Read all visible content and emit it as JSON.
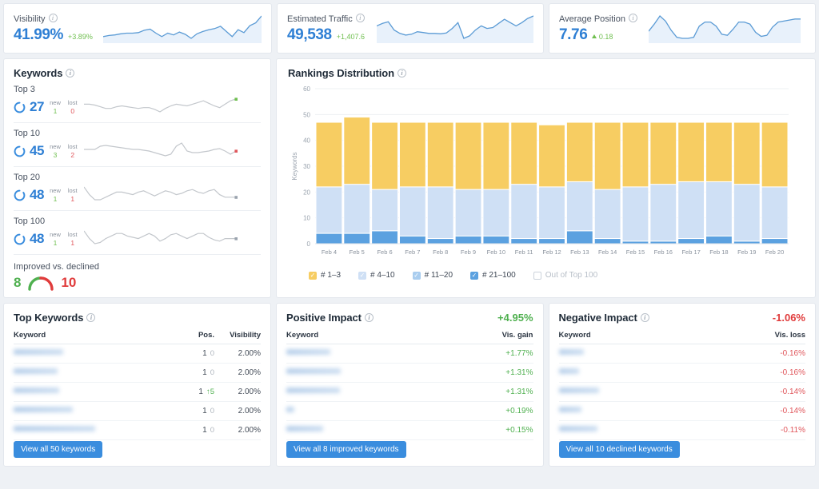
{
  "kpis": [
    {
      "label": "Visibility",
      "value": "41.99%",
      "delta": "+3.89%",
      "delta_dir": "up",
      "name": "visibility"
    },
    {
      "label": "Estimated Traffic",
      "value": "49,538",
      "delta": "+1,407.6",
      "delta_dir": "up",
      "name": "estimated-traffic"
    },
    {
      "label": "Average Position",
      "value": "7.76",
      "delta": "0.18",
      "delta_dir": "up",
      "name": "average-position"
    }
  ],
  "kpi_sparks": {
    "visibility": [
      52,
      50,
      49,
      47,
      46,
      46,
      45,
      41,
      39,
      46,
      52,
      46,
      49,
      44,
      48,
      55,
      47,
      43,
      40,
      38,
      34,
      43,
      52,
      40,
      45,
      33,
      28,
      16
    ],
    "estimated_traffic": [
      30,
      24,
      20,
      40,
      48,
      52,
      50,
      44,
      46,
      48,
      48,
      49,
      47,
      36,
      22,
      60,
      54,
      40,
      30,
      36,
      34,
      24,
      14,
      22,
      30,
      22,
      12,
      6
    ],
    "average_position": [
      44,
      30,
      14,
      24,
      42,
      56,
      58,
      58,
      56,
      34,
      26,
      26,
      34,
      50,
      52,
      40,
      26,
      26,
      30,
      46,
      54,
      52,
      36,
      26,
      24,
      22,
      20,
      20
    ]
  },
  "keywords_panel": {
    "title": "Keywords",
    "tiers": [
      {
        "tier": "Top 3",
        "count": "27",
        "new": "1",
        "lost": "0",
        "end_dot": "green",
        "spark": [
          30,
          30,
          29,
          27,
          25,
          25,
          27,
          28,
          27,
          26,
          25,
          26,
          26,
          24,
          21,
          25,
          28,
          30,
          29,
          28,
          30,
          32,
          34,
          31,
          28,
          26,
          30,
          34,
          36
        ]
      },
      {
        "tier": "Top 10",
        "count": "45",
        "new": "3",
        "lost": "2",
        "end_dot": "red",
        "spark": [
          26,
          26,
          26,
          30,
          31,
          30,
          29,
          28,
          27,
          26,
          26,
          25,
          24,
          22,
          20,
          18,
          20,
          30,
          34,
          24,
          22,
          22,
          23,
          24,
          26,
          27,
          24,
          20,
          24
        ]
      },
      {
        "tier": "Top 20",
        "count": "48",
        "new": "1",
        "lost": "1",
        "end_dot": "grey",
        "spark": [
          30,
          24,
          20,
          20,
          22,
          24,
          26,
          26,
          25,
          24,
          26,
          27,
          25,
          23,
          25,
          27,
          26,
          24,
          25,
          27,
          28,
          26,
          25,
          27,
          28,
          24,
          22,
          22,
          22
        ]
      },
      {
        "tier": "Top 100",
        "count": "48",
        "new": "1",
        "lost": "1",
        "end_dot": "grey",
        "spark": [
          30,
          24,
          20,
          21,
          24,
          26,
          28,
          28,
          26,
          25,
          24,
          26,
          28,
          26,
          22,
          24,
          27,
          28,
          26,
          24,
          26,
          28,
          28,
          25,
          23,
          22,
          24,
          24,
          24
        ]
      }
    ],
    "new_caption": "new",
    "lost_caption": "lost",
    "improved_label": "Improved vs. declined",
    "improved": "8",
    "declined": "10"
  },
  "rankings": {
    "title": "Rankings Distribution",
    "legend": [
      {
        "label": "# 1–3",
        "color": "#f7cd62",
        "checked": true
      },
      {
        "label": "# 4–10",
        "color": "#cfe0f5",
        "checked": true
      },
      {
        "label": "# 11–20",
        "color": "#a9cdef",
        "checked": true
      },
      {
        "label": "# 21–100",
        "color": "#5ba1e0",
        "checked": true
      },
      {
        "label": "Out of Top 100",
        "color": "#ffffff",
        "checked": false
      }
    ]
  },
  "chart_data": {
    "type": "bar",
    "title": "Rankings Distribution",
    "xlabel": "",
    "ylabel": "Keywords",
    "ylim": [
      0,
      60
    ],
    "yticks": [
      0,
      10,
      20,
      30,
      40,
      50,
      60
    ],
    "grid": true,
    "stacked": true,
    "legend_position": "bottom",
    "categories": [
      "Feb 4",
      "Feb 5",
      "Feb 6",
      "Feb 7",
      "Feb 8",
      "Feb 9",
      "Feb 10",
      "Feb 11",
      "Feb 12",
      "Feb 13",
      "Feb 14",
      "Feb 15",
      "Feb 16",
      "Feb 17",
      "Feb 18",
      "Feb 19",
      "Feb 20"
    ],
    "series": [
      {
        "name": "# 21–100",
        "color": "#5ba1e0",
        "values": [
          4,
          4,
          5,
          3,
          2,
          3,
          3,
          2,
          2,
          5,
          2,
          1,
          1,
          2,
          3,
          1,
          2
        ]
      },
      {
        "name": "# 11–20",
        "color": "#a9cdef",
        "values": [
          0,
          0,
          0,
          0,
          0,
          0,
          0,
          0,
          0,
          0,
          0,
          0,
          0,
          0,
          0,
          0,
          0
        ]
      },
      {
        "name": "# 4–10",
        "color": "#cfe0f5",
        "values": [
          18,
          19,
          16,
          19,
          20,
          18,
          18,
          21,
          20,
          19,
          19,
          21,
          22,
          22,
          21,
          22,
          20
        ]
      },
      {
        "name": "# 1–3",
        "color": "#f7cd62",
        "values": [
          25,
          26,
          26,
          25,
          25,
          26,
          26,
          24,
          24,
          23,
          26,
          25,
          24,
          23,
          23,
          24,
          25
        ]
      }
    ],
    "totals": [
      47,
      49,
      47,
      47,
      47,
      47,
      47,
      47,
      46,
      47,
      47,
      47,
      47,
      47,
      47,
      47,
      47
    ]
  },
  "top_keywords": {
    "title": "Top Keywords",
    "columns": [
      "Keyword",
      "Pos.",
      "Visibility"
    ],
    "rows": [
      {
        "keyword_width": 62,
        "pos": "1",
        "delta": "0",
        "delta_dir": "none",
        "visibility": "2.00%"
      },
      {
        "keyword_width": 55,
        "pos": "1",
        "delta": "0",
        "delta_dir": "none",
        "visibility": "2.00%"
      },
      {
        "keyword_width": 57,
        "pos": "1",
        "delta": "5",
        "delta_dir": "up",
        "visibility": "2.00%"
      },
      {
        "keyword_width": 74,
        "pos": "1",
        "delta": "0",
        "delta_dir": "none",
        "visibility": "2.00%"
      },
      {
        "keyword_width": 102,
        "pos": "1",
        "delta": "0",
        "delta_dir": "none",
        "visibility": "2.00%"
      }
    ],
    "button": "View all 50 keywords"
  },
  "positive_impact": {
    "title": "Positive Impact",
    "total": "+4.95%",
    "columns": [
      "Keyword",
      "Vis. gain"
    ],
    "rows": [
      {
        "keyword_width": 55,
        "value": "+1.77%"
      },
      {
        "keyword_width": 68,
        "value": "+1.31%"
      },
      {
        "keyword_width": 67,
        "value": "+1.31%"
      },
      {
        "keyword_width": 10,
        "value": "+0.19%"
      },
      {
        "keyword_width": 46,
        "value": "+0.15%"
      }
    ],
    "button": "View all 8 improved keywords"
  },
  "negative_impact": {
    "title": "Negative Impact",
    "total": "-1.06%",
    "columns": [
      "Keyword",
      "Vis. loss"
    ],
    "rows": [
      {
        "keyword_width": 31,
        "value": "-0.16%"
      },
      {
        "keyword_width": 25,
        "value": "-0.16%"
      },
      {
        "keyword_width": 50,
        "value": "-0.14%"
      },
      {
        "keyword_width": 28,
        "value": "-0.14%"
      },
      {
        "keyword_width": 48,
        "value": "-0.11%"
      }
    ],
    "button": "View all 10 declined keywords"
  }
}
